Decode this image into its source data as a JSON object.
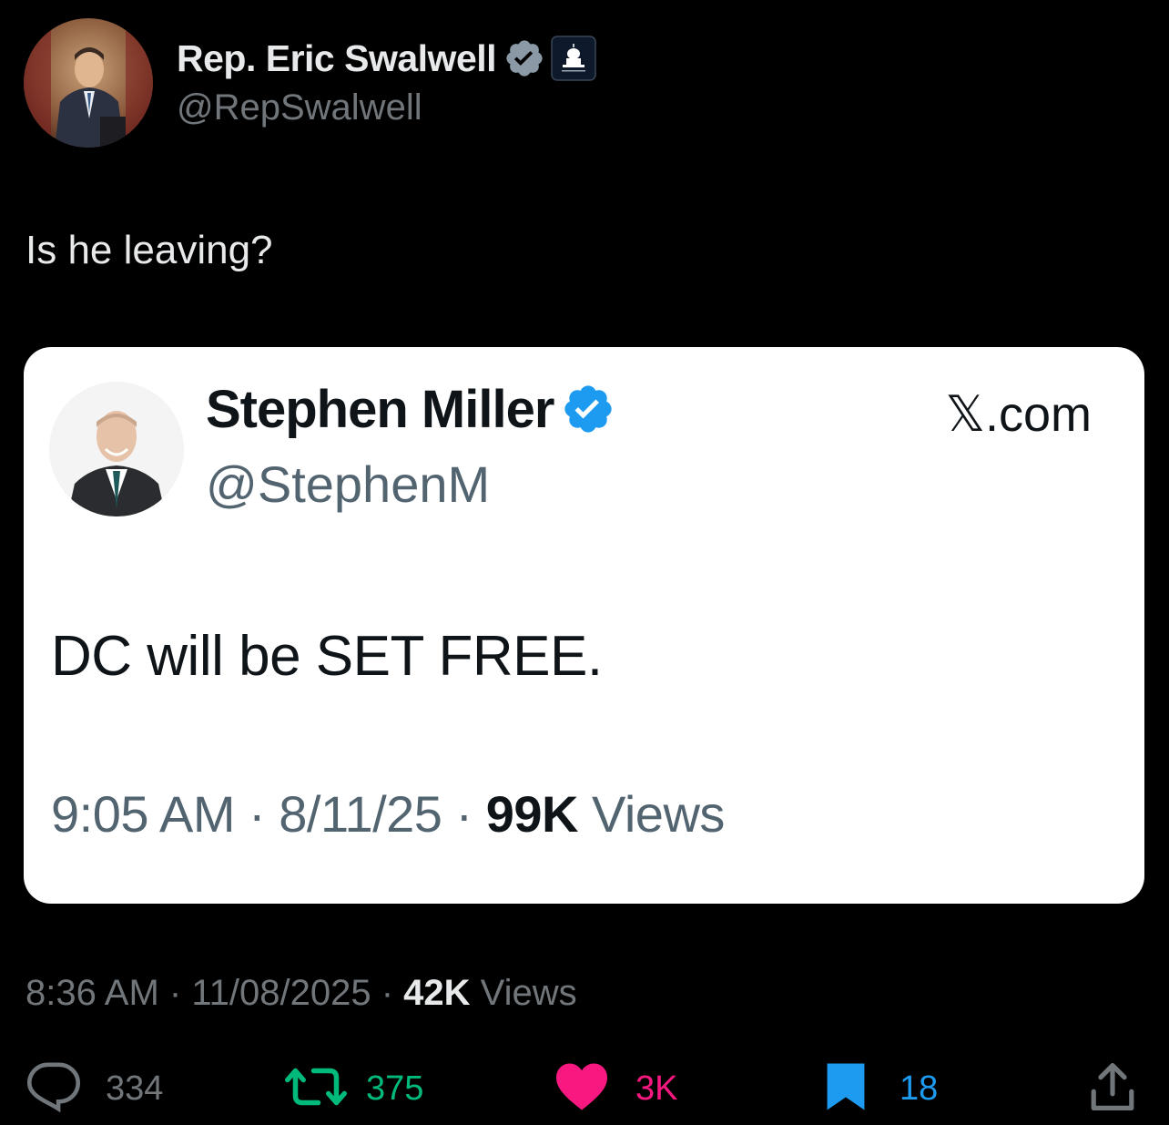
{
  "author": {
    "display_name": "Rep. Eric Swalwell",
    "handle": "@RepSwalwell"
  },
  "post": {
    "text": "Is he leaving?",
    "time": "8:36 AM",
    "date": "11/08/2025",
    "views_count": "42K",
    "views_label": "Views",
    "separator": "·"
  },
  "quoted": {
    "display_name": "Stephen Miller",
    "handle": "@StephenM",
    "source": "𝕏.com",
    "text": "DC will be SET FREE.",
    "time": "9:05 AM",
    "date": "8/11/25",
    "views_count": "99K",
    "views_label": "Views",
    "separator": "·"
  },
  "actions": {
    "replies": "334",
    "reposts": "375",
    "likes": "3K",
    "bookmarks": "18"
  },
  "colors": {
    "background": "#000000",
    "verified": "#1d9bf0",
    "repost": "#00ba7c",
    "like": "#f91880",
    "bookmark": "#1d9bf0",
    "muted": "#71767b"
  },
  "icons": {
    "verified": "verified-badge-icon",
    "affiliation": "capitol-icon",
    "reply": "reply-icon",
    "repost": "repost-icon",
    "like": "heart-icon",
    "bookmark": "bookmark-icon",
    "share": "share-icon"
  }
}
